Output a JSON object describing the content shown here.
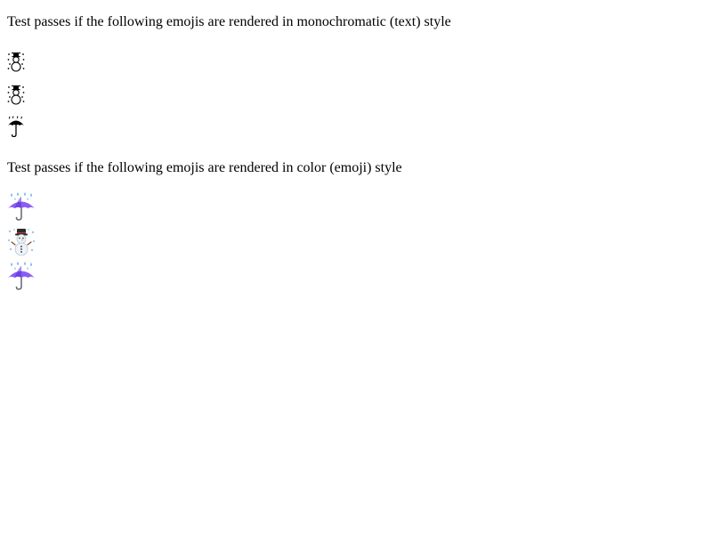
{
  "monochrome_section": {
    "heading": "Test passes if the following emojis are rendered in monochromatic (text) style",
    "emojis": [
      {
        "icon": "snowman-with-snow-icon",
        "style": "text"
      },
      {
        "icon": "snowman-with-snow-icon",
        "style": "text"
      },
      {
        "icon": "umbrella-with-rain-icon",
        "style": "text"
      }
    ]
  },
  "color_section": {
    "heading": "Test passes if the following emojis are rendered in color (emoji) style",
    "emojis": [
      {
        "icon": "umbrella-with-rain-icon",
        "style": "emoji"
      },
      {
        "icon": "snowman-with-snow-icon",
        "style": "emoji"
      },
      {
        "icon": "umbrella-with-rain-icon",
        "style": "emoji"
      }
    ]
  },
  "colors": {
    "text": "#000000",
    "background": "#ffffff",
    "umbrella_canopy": "#8a5cf6",
    "umbrella_canopy_dark": "#5a2fd0",
    "rain_drop": "#4aa3f0",
    "snowman_body": "#eef3f8",
    "snowman_hat": "#2b2b2b"
  }
}
